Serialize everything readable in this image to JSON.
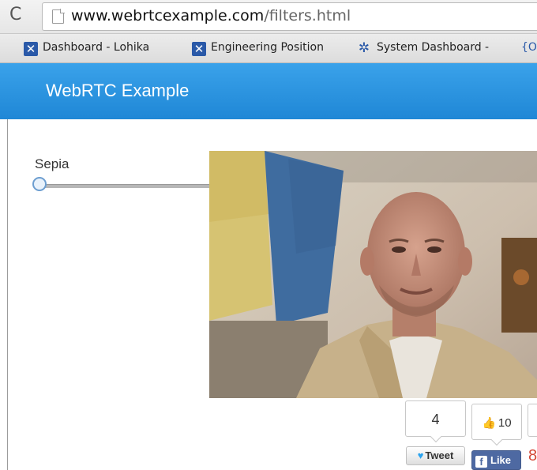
{
  "browser": {
    "url_host": "www.webrtcexample.com",
    "url_path": "/filters.html",
    "bookmarks": [
      {
        "label": "Dashboard - Lohika",
        "icon": "jira-icon"
      },
      {
        "label": "Engineering Position",
        "icon": "jira-icon"
      },
      {
        "label": "System Dashboard -",
        "icon": "system-dashboard-icon"
      },
      {
        "label": "{O",
        "icon": "none"
      }
    ]
  },
  "navbar": {
    "brand": "WebRTC Example"
  },
  "filter": {
    "label": "Sepia",
    "slider_value": 0
  },
  "social": {
    "tweet_count": "4",
    "tweet_label": "Tweet",
    "like_count": "10",
    "like_label": "Like"
  },
  "colors": {
    "navbar": "#2a93df",
    "facebook": "#4e69a2",
    "twitter": "#2aa3ef"
  }
}
